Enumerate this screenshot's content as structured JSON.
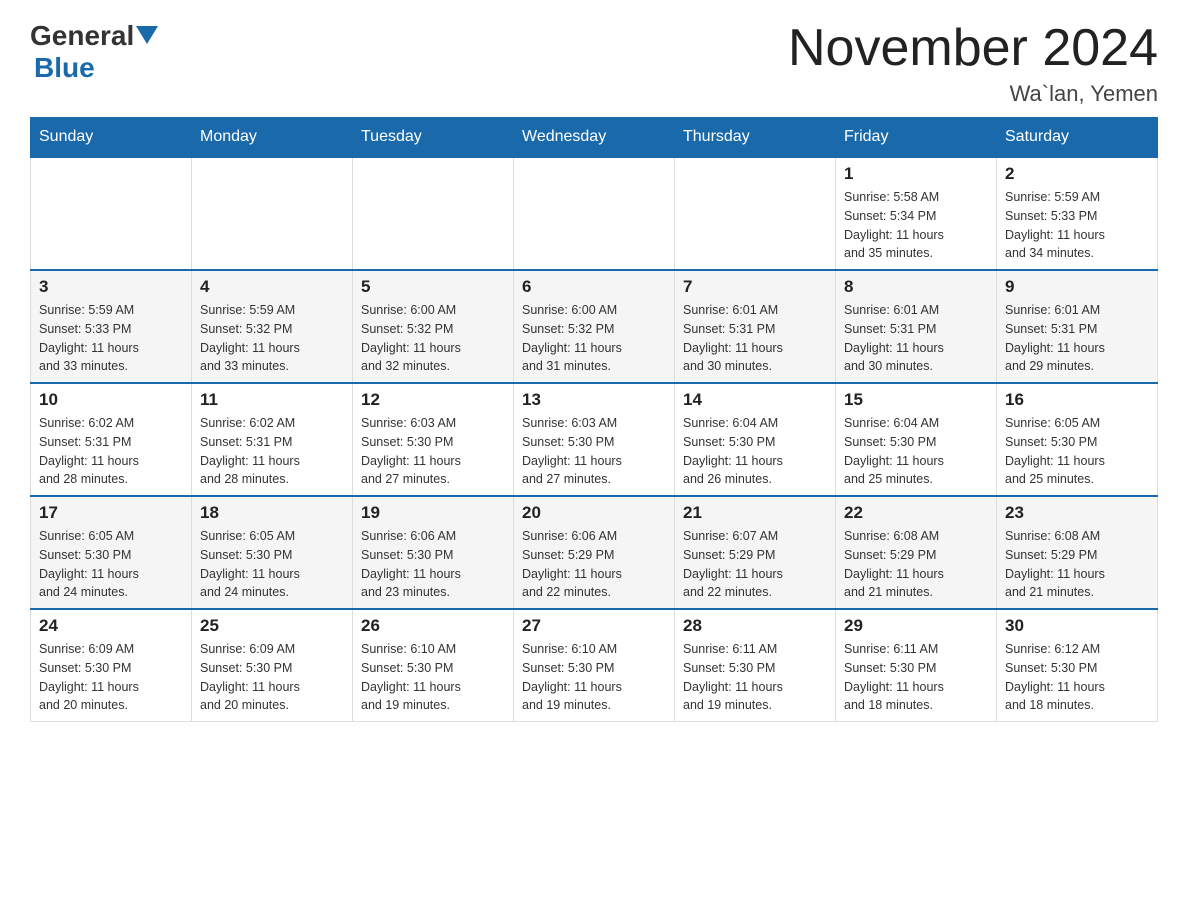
{
  "header": {
    "logo_general": "General",
    "logo_blue": "Blue",
    "month_title": "November 2024",
    "location": "Wa`lan, Yemen"
  },
  "weekdays": [
    "Sunday",
    "Monday",
    "Tuesday",
    "Wednesday",
    "Thursday",
    "Friday",
    "Saturday"
  ],
  "weeks": [
    [
      {
        "day": "",
        "info": ""
      },
      {
        "day": "",
        "info": ""
      },
      {
        "day": "",
        "info": ""
      },
      {
        "day": "",
        "info": ""
      },
      {
        "day": "",
        "info": ""
      },
      {
        "day": "1",
        "info": "Sunrise: 5:58 AM\nSunset: 5:34 PM\nDaylight: 11 hours\nand 35 minutes."
      },
      {
        "day": "2",
        "info": "Sunrise: 5:59 AM\nSunset: 5:33 PM\nDaylight: 11 hours\nand 34 minutes."
      }
    ],
    [
      {
        "day": "3",
        "info": "Sunrise: 5:59 AM\nSunset: 5:33 PM\nDaylight: 11 hours\nand 33 minutes."
      },
      {
        "day": "4",
        "info": "Sunrise: 5:59 AM\nSunset: 5:32 PM\nDaylight: 11 hours\nand 33 minutes."
      },
      {
        "day": "5",
        "info": "Sunrise: 6:00 AM\nSunset: 5:32 PM\nDaylight: 11 hours\nand 32 minutes."
      },
      {
        "day": "6",
        "info": "Sunrise: 6:00 AM\nSunset: 5:32 PM\nDaylight: 11 hours\nand 31 minutes."
      },
      {
        "day": "7",
        "info": "Sunrise: 6:01 AM\nSunset: 5:31 PM\nDaylight: 11 hours\nand 30 minutes."
      },
      {
        "day": "8",
        "info": "Sunrise: 6:01 AM\nSunset: 5:31 PM\nDaylight: 11 hours\nand 30 minutes."
      },
      {
        "day": "9",
        "info": "Sunrise: 6:01 AM\nSunset: 5:31 PM\nDaylight: 11 hours\nand 29 minutes."
      }
    ],
    [
      {
        "day": "10",
        "info": "Sunrise: 6:02 AM\nSunset: 5:31 PM\nDaylight: 11 hours\nand 28 minutes."
      },
      {
        "day": "11",
        "info": "Sunrise: 6:02 AM\nSunset: 5:31 PM\nDaylight: 11 hours\nand 28 minutes."
      },
      {
        "day": "12",
        "info": "Sunrise: 6:03 AM\nSunset: 5:30 PM\nDaylight: 11 hours\nand 27 minutes."
      },
      {
        "day": "13",
        "info": "Sunrise: 6:03 AM\nSunset: 5:30 PM\nDaylight: 11 hours\nand 27 minutes."
      },
      {
        "day": "14",
        "info": "Sunrise: 6:04 AM\nSunset: 5:30 PM\nDaylight: 11 hours\nand 26 minutes."
      },
      {
        "day": "15",
        "info": "Sunrise: 6:04 AM\nSunset: 5:30 PM\nDaylight: 11 hours\nand 25 minutes."
      },
      {
        "day": "16",
        "info": "Sunrise: 6:05 AM\nSunset: 5:30 PM\nDaylight: 11 hours\nand 25 minutes."
      }
    ],
    [
      {
        "day": "17",
        "info": "Sunrise: 6:05 AM\nSunset: 5:30 PM\nDaylight: 11 hours\nand 24 minutes."
      },
      {
        "day": "18",
        "info": "Sunrise: 6:05 AM\nSunset: 5:30 PM\nDaylight: 11 hours\nand 24 minutes."
      },
      {
        "day": "19",
        "info": "Sunrise: 6:06 AM\nSunset: 5:30 PM\nDaylight: 11 hours\nand 23 minutes."
      },
      {
        "day": "20",
        "info": "Sunrise: 6:06 AM\nSunset: 5:29 PM\nDaylight: 11 hours\nand 22 minutes."
      },
      {
        "day": "21",
        "info": "Sunrise: 6:07 AM\nSunset: 5:29 PM\nDaylight: 11 hours\nand 22 minutes."
      },
      {
        "day": "22",
        "info": "Sunrise: 6:08 AM\nSunset: 5:29 PM\nDaylight: 11 hours\nand 21 minutes."
      },
      {
        "day": "23",
        "info": "Sunrise: 6:08 AM\nSunset: 5:29 PM\nDaylight: 11 hours\nand 21 minutes."
      }
    ],
    [
      {
        "day": "24",
        "info": "Sunrise: 6:09 AM\nSunset: 5:30 PM\nDaylight: 11 hours\nand 20 minutes."
      },
      {
        "day": "25",
        "info": "Sunrise: 6:09 AM\nSunset: 5:30 PM\nDaylight: 11 hours\nand 20 minutes."
      },
      {
        "day": "26",
        "info": "Sunrise: 6:10 AM\nSunset: 5:30 PM\nDaylight: 11 hours\nand 19 minutes."
      },
      {
        "day": "27",
        "info": "Sunrise: 6:10 AM\nSunset: 5:30 PM\nDaylight: 11 hours\nand 19 minutes."
      },
      {
        "day": "28",
        "info": "Sunrise: 6:11 AM\nSunset: 5:30 PM\nDaylight: 11 hours\nand 19 minutes."
      },
      {
        "day": "29",
        "info": "Sunrise: 6:11 AM\nSunset: 5:30 PM\nDaylight: 11 hours\nand 18 minutes."
      },
      {
        "day": "30",
        "info": "Sunrise: 6:12 AM\nSunset: 5:30 PM\nDaylight: 11 hours\nand 18 minutes."
      }
    ]
  ]
}
